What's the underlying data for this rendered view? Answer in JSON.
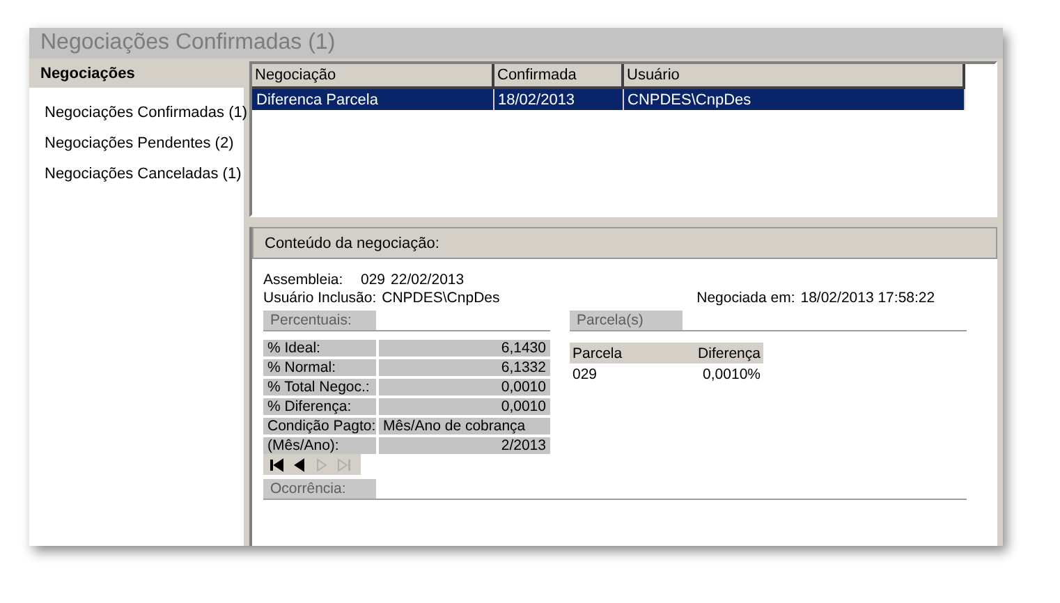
{
  "window": {
    "title": "Negociações Confirmadas (1)"
  },
  "sidebar": {
    "header": "Negociações",
    "items": [
      {
        "label": "Negociações Confirmadas (1)"
      },
      {
        "label": "Negociações Pendentes (2)"
      },
      {
        "label": "Negociações Canceladas (1)"
      }
    ]
  },
  "table": {
    "columns": [
      "Negociação",
      "Confirmada",
      "Usuário"
    ],
    "rows": [
      {
        "cells": [
          "Diferenca Parcela",
          "18/02/2013",
          "CNPDES\\CnpDes"
        ],
        "selected": true
      }
    ]
  },
  "detail": {
    "header": "Conteúdo da negociação:",
    "assembleia_label": "Assembleia:",
    "assembleia_number": "029",
    "assembleia_date": "22/02/2013",
    "usuario_label": "Usuário Inclusão:",
    "usuario_value": "CNPDES\\CnpDes",
    "negociada_label": "Negociada em:",
    "negociada_value": "18/02/2013 17:58:22",
    "percentuais": {
      "title": "Percentuais:",
      "rows": [
        {
          "label": "% Ideal:",
          "value": "6,1430",
          "kind": "number"
        },
        {
          "label": "% Normal:",
          "value": "6,1332",
          "kind": "number"
        },
        {
          "label": "% Total Negoc.:",
          "value": "0,0010",
          "kind": "number"
        },
        {
          "label": "% Diferença:",
          "value": "0,0010",
          "kind": "number"
        },
        {
          "label": "Condição Pagto:",
          "value": "Mês/Ano de cobrança",
          "kind": "text"
        },
        {
          "label": "(Mês/Ano):",
          "value": "2/2013",
          "kind": "number"
        }
      ]
    },
    "navigator": [
      {
        "kind": "first",
        "disabled": false
      },
      {
        "kind": "prev",
        "disabled": false
      },
      {
        "kind": "next",
        "disabled": true
      },
      {
        "kind": "last",
        "disabled": true
      }
    ],
    "parcelas": {
      "title": "Parcela(s)",
      "columns": [
        "Parcela",
        "Diferença"
      ],
      "rows": [
        [
          "029",
          "0,0010%"
        ]
      ]
    },
    "ocorrencia": {
      "title": "Ocorrência:"
    }
  }
}
